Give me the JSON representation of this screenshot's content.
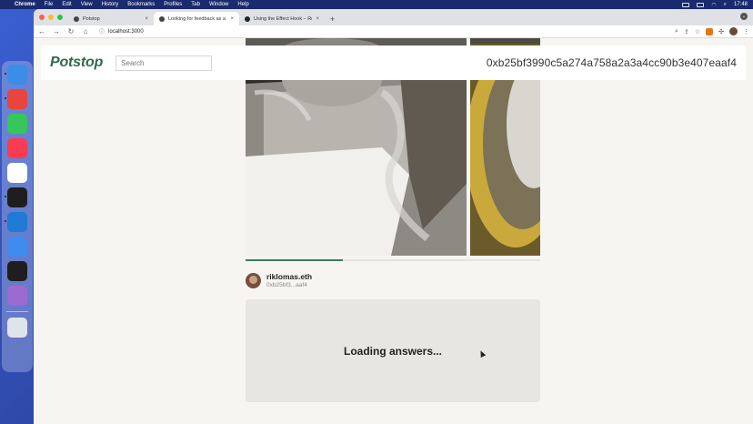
{
  "menubar": {
    "apple": "",
    "app": "Chrome",
    "items": [
      "File",
      "Edit",
      "View",
      "History",
      "Bookmarks",
      "Profiles",
      "Tab",
      "Window",
      "Help"
    ],
    "clock": "17:48"
  },
  "dock": {
    "apps": [
      {
        "name": "finder-icon",
        "color": "#3a8ee6"
      },
      {
        "name": "chrome-icon",
        "color": "#e8453c"
      },
      {
        "name": "messages-icon",
        "color": "#35c759"
      },
      {
        "name": "music-icon",
        "color": "#fa3c52"
      },
      {
        "name": "slack-icon",
        "color": "#ffffff"
      },
      {
        "name": "terminal-icon",
        "color": "#1e1e1e"
      },
      {
        "name": "vscode-icon",
        "color": "#1f7ad4"
      },
      {
        "name": "mail-icon",
        "color": "#3f8cf0"
      },
      {
        "name": "figma-icon",
        "color": "#1e1e1e"
      },
      {
        "name": "photos-icon",
        "color": "#9b6bcf"
      },
      {
        "name": "trash-icon",
        "color": "#dfe4ea"
      }
    ]
  },
  "browser": {
    "tabs": [
      {
        "title": "Potstop",
        "active": false
      },
      {
        "title": "Looking for feedback as a beginner",
        "active": true
      },
      {
        "title": "Using the Effect Hook – React",
        "active": false
      }
    ],
    "address": "localhost:3000"
  },
  "site": {
    "logo": "Potstop",
    "search_placeholder": "Search",
    "wallet_address": "0xb25bf3990c5a274a758a2a3a4cc90b3e407eaaf4",
    "post": {
      "username": "riklomas.eth",
      "short_address": "0xb25bf3...aaf4",
      "progress": 0.33,
      "answers_status": "Loading answers..."
    }
  }
}
